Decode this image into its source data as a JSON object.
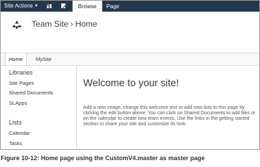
{
  "ribbon": {
    "site_actions": "Site Actions",
    "tabs": [
      "Browse",
      "Page"
    ]
  },
  "header": {
    "site_title": "Team Site",
    "separator": "›",
    "page_name": "Home"
  },
  "topnav": {
    "items": [
      "Home",
      "MySite"
    ]
  },
  "quicklaunch": {
    "libraries_heading": "Libraries",
    "libraries": [
      "Site Pages",
      "Shared Documents",
      "SLApps"
    ],
    "lists_heading": "Lists",
    "lists": [
      "Calendar",
      "Tasks"
    ]
  },
  "main": {
    "welcome_title": "Welcome to your site!",
    "body": "Add a new image, change this welcome text or add new lists to this page by clicking the edit button above. You can click on Shared Documents to add files or on the calendar to create new team events. Use the links in the getting started section to share your site and customize its look."
  },
  "caption": "Figure 10-12:  Home page using the CustomV4.master as master page",
  "colors": {
    "ribbon_bg": "#21374c",
    "text": "#3b3b3b"
  }
}
